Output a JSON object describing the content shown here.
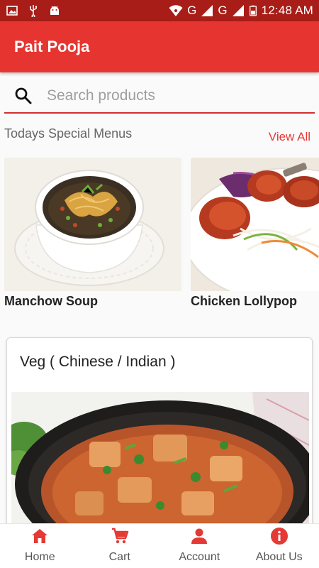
{
  "status_bar": {
    "time": "12:48 AM",
    "network_1": "G",
    "network_2": "G"
  },
  "app": {
    "title": "Pait Pooja"
  },
  "search": {
    "placeholder": "Search products"
  },
  "specials": {
    "title": "Todays Special Menus",
    "view_all_label": "View All",
    "items": [
      {
        "name": "Manchow Soup"
      },
      {
        "name": "Chicken Lollypop"
      }
    ]
  },
  "category": {
    "title": "Veg ( Chinese / Indian )"
  },
  "bottom_nav": {
    "items": [
      {
        "label": "Home",
        "icon": "home-icon"
      },
      {
        "label": "Cart",
        "icon": "cart-icon"
      },
      {
        "label": "Account",
        "icon": "account-icon"
      },
      {
        "label": "About Us",
        "icon": "info-icon"
      }
    ]
  },
  "colors": {
    "primary": "#e63530",
    "primary_dark": "#a81d17",
    "accent": "#e53935"
  }
}
